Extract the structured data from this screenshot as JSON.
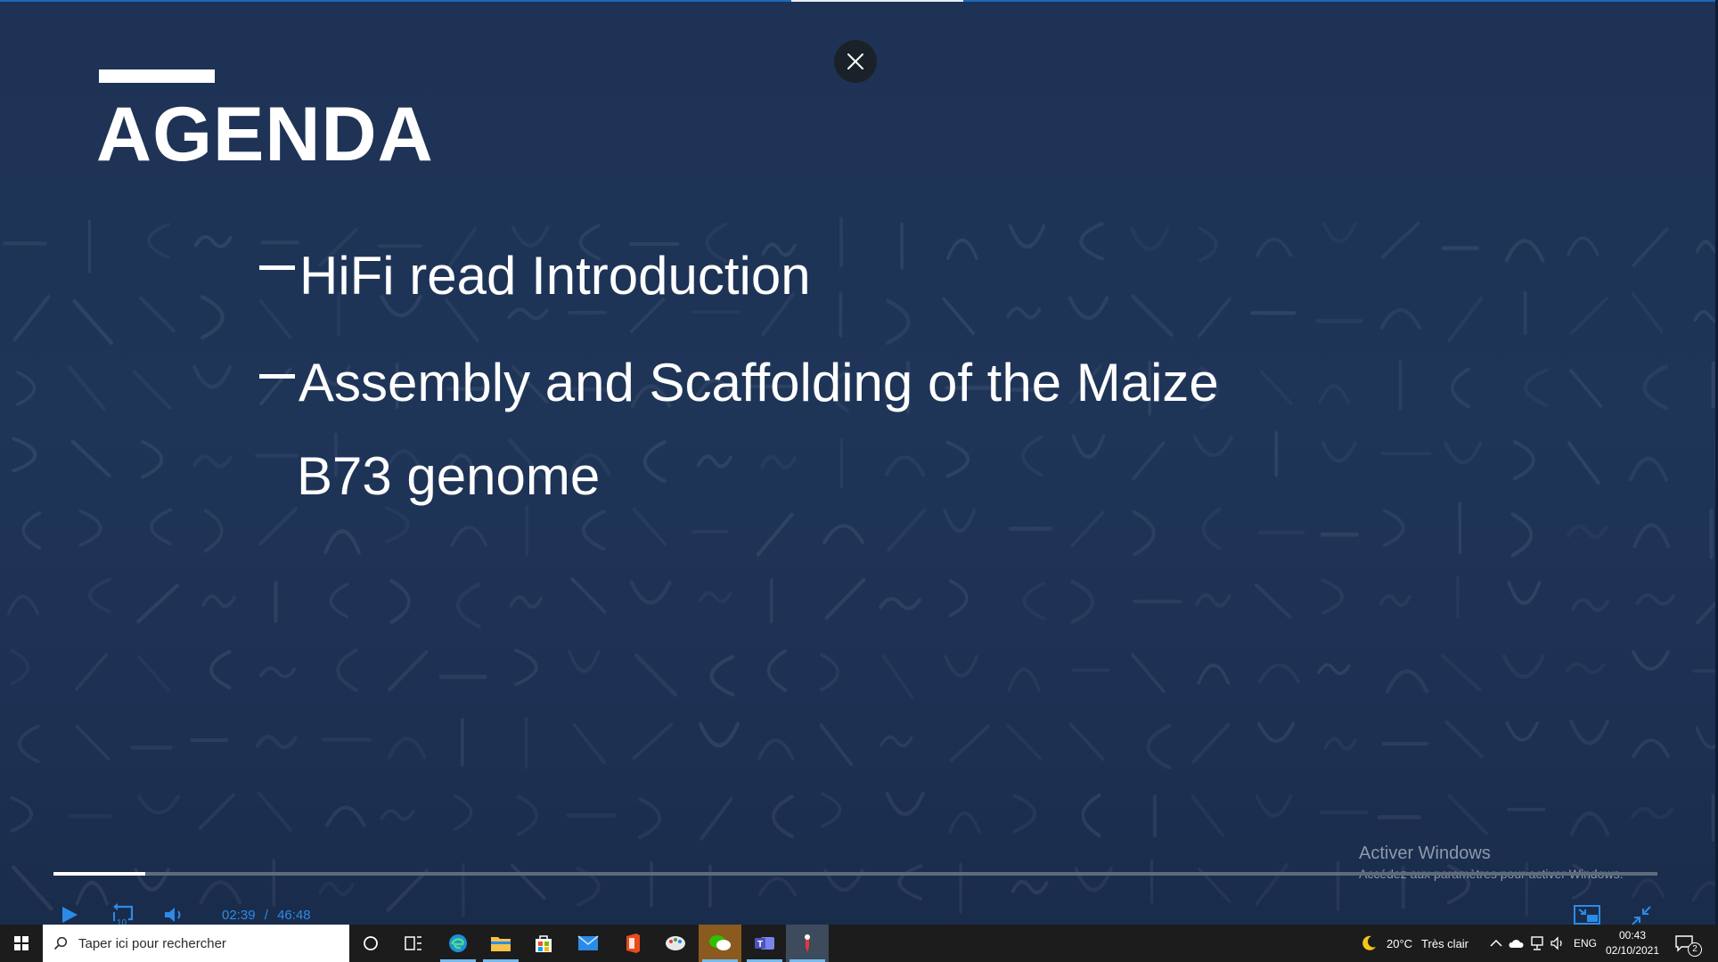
{
  "slide": {
    "title": "AGENDA",
    "items": [
      "HiFi read Introduction",
      "Assembly and Scaffolding of the Maize",
      "B73 genome"
    ]
  },
  "watermark": {
    "line1": "Activer Windows",
    "line2": "Accédez aux paramètres pour activer Windows."
  },
  "player": {
    "current_time": "02:39",
    "separator": "/",
    "total_time": "46:48",
    "progress": 0.057,
    "accent_color": "#2b8be6"
  },
  "taskbar": {
    "search_placeholder": "Taper ici pour rechercher",
    "apps": [
      "cortana-icon",
      "task-view-icon",
      "edge-icon",
      "file-explorer-icon",
      "store-icon",
      "mail-icon",
      "office-icon",
      "paint-icon",
      "wechat-icon",
      "teams-icon",
      "pointer-app-icon"
    ],
    "weather_temp": "20°C",
    "weather_desc": "Très clair",
    "language": "ENG",
    "clock_time": "00:43",
    "clock_date": "02/10/2021",
    "notification_count": "2"
  }
}
